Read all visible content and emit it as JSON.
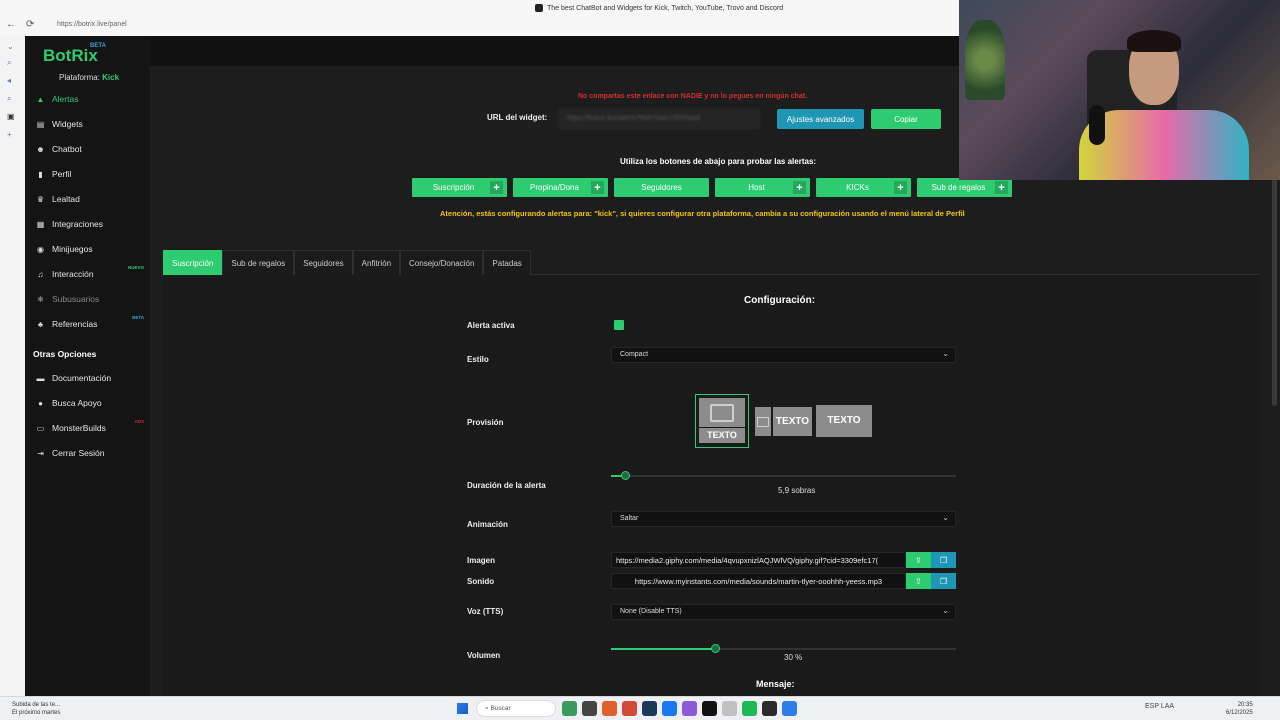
{
  "browser": {
    "url": "https://botrix.live/panel",
    "tab_title": "The best ChatBot and Widgets for Kick, Twitch, YouTube, Trovo and Discord"
  },
  "sidebar": {
    "logo": "BotRix",
    "logo_badge": "BETA",
    "platform_label": "Plataforma:",
    "platform_value": "Kick",
    "items": [
      {
        "label": "Alertas",
        "icon": "bell-icon"
      },
      {
        "label": "Widgets",
        "icon": "widgets-icon"
      },
      {
        "label": "Chatbot",
        "icon": "robot-icon"
      },
      {
        "label": "Perfil",
        "icon": "user-icon"
      },
      {
        "label": "Lealtad",
        "icon": "trophy-icon"
      },
      {
        "label": "Integraciones",
        "icon": "plug-icon"
      },
      {
        "label": "Minijuegos",
        "icon": "gamepad-icon"
      },
      {
        "label": "Interacción",
        "icon": "music-icon",
        "tag": "NUEVO"
      },
      {
        "label": "Subusuarios",
        "icon": "subusers-icon"
      },
      {
        "label": "Referencias",
        "icon": "users-icon",
        "tag": "BETA"
      }
    ],
    "other_heading": "Otras Opciones",
    "other_items": [
      {
        "label": "Documentación",
        "icon": "book-icon"
      },
      {
        "label": "Busca Apoyo",
        "icon": "help-icon"
      },
      {
        "label": "MonsterBuilds",
        "icon": "laptop-icon",
        "tag": "ADS"
      },
      {
        "label": "Cerrar Sesión",
        "icon": "logout-icon"
      }
    ],
    "colors": {
      "accent": "#2ecc71",
      "beta": "#36a3d9",
      "ads": "#d32f2f"
    }
  },
  "widget": {
    "warning": "No compartas este enlace con NADIE y no lo pegues en ningún chat.",
    "url_label": "URL del widget:",
    "url_value": "https://botrix.live/alerts?bid=1b4c10065aa9",
    "advanced_button": "Ajustes avanzados",
    "copy_button": "Copiar"
  },
  "test": {
    "instruction": "Utiliza los botones de abajo para probar las alertas:",
    "buttons": [
      {
        "label": "Suscripción",
        "plus": "+"
      },
      {
        "label": "Propina/Dona",
        "plus": "+"
      },
      {
        "label": "Seguidores",
        "plus": ""
      },
      {
        "label": "Host",
        "plus": "+"
      },
      {
        "label": "KICKs",
        "plus": "+"
      },
      {
        "label": "Sub de regalos",
        "plus": "+"
      }
    ],
    "attention": "Atención, estás configurando alertas para: \"kick\", si quieres configurar otra plataforma, cambia a su configuración usando el menú lateral de Perfil"
  },
  "tabs": [
    "Suscripción",
    "Sub de regalos",
    "Seguidores",
    "Anfitrión",
    "Consejo/Donación",
    "Patadas"
  ],
  "config": {
    "title": "Configuración:",
    "active_label": "Alerta activa",
    "style_label": "Estilo",
    "style_value": "Compact",
    "layout_label": "Provisión",
    "layout_text": "TEXTO",
    "duration_label": "Duración de la alerta",
    "duration_value": "5,9",
    "duration_unit": "sobras",
    "duration_fraction": 0.04,
    "animation_label": "Animación",
    "animation_value": "Saltar",
    "image_label": "Imagen",
    "image_url": "https://media2.giphy.com/media/4qvupxnizlAQJWlVQ/giphy.gif?cid=3309efc17(",
    "sound_label": "Sonido",
    "sound_url": "https://www.myinstants.com/media/sounds/martin-tlyer-ooohhh-yeess.mp3",
    "tts_label": "Voz (TTS)",
    "tts_value": "None (Disable TTS)",
    "volume_label": "Volumen",
    "volume_value": "30",
    "volume_unit": "%",
    "volume_fraction": 0.3,
    "message_title": "Mensaje:"
  },
  "taskbar": {
    "weather_line1": "Subida de las te...",
    "weather_line2": "El próximo martes",
    "search_placeholder": "Buscar",
    "lang_line1": "ESP",
    "lang_line2": "LAA",
    "time": "20:35",
    "date": "6/12/2025"
  }
}
